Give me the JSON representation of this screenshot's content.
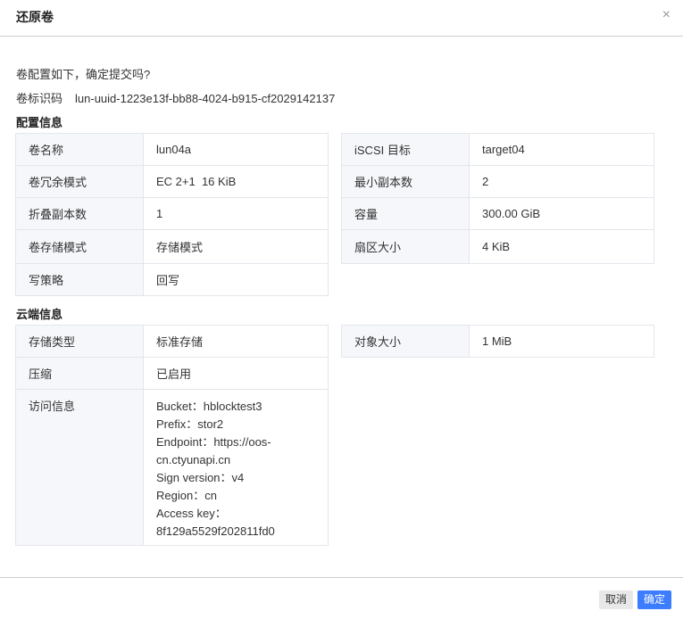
{
  "dialog": {
    "title": "还原卷",
    "close_icon": "×"
  },
  "confirm_text": "卷配置如下，确定提交吗?",
  "uuid": {
    "label": "卷标识码",
    "value": "lun-uuid-1223e13f-bb88-4024-b915-cf2029142137"
  },
  "config": {
    "heading": "配置信息",
    "left": [
      {
        "label": "卷名称",
        "value": "lun04a"
      },
      {
        "label": "卷冗余模式",
        "value": "EC 2+1  16 KiB"
      },
      {
        "label": "折叠副本数",
        "value": "1"
      },
      {
        "label": "卷存储模式",
        "value": "存储模式"
      },
      {
        "label": "写策略",
        "value": "回写"
      }
    ],
    "right": [
      {
        "label": "iSCSI 目标",
        "value": "target04"
      },
      {
        "label": "最小副本数",
        "value": "2"
      },
      {
        "label": "容量",
        "value": "300.00 GiB"
      },
      {
        "label": "扇区大小",
        "value": "4 KiB"
      }
    ]
  },
  "cloud": {
    "heading": "云端信息",
    "left": [
      {
        "label": "存储类型",
        "value": "标准存储"
      },
      {
        "label": "压缩",
        "value": "已启用"
      }
    ],
    "access": {
      "label": "访问信息",
      "lines": [
        "Bucket：hblocktest3",
        "Prefix：stor2",
        "Endpoint：https://oos-",
        "cn.ctyunapi.cn",
        "Sign version：v4",
        "Region：cn",
        "Access key：",
        "8f129a5529f202811fd0"
      ]
    },
    "right": [
      {
        "label": "对象大小",
        "value": "1 MiB"
      }
    ]
  },
  "footer": {
    "cancel": "取消",
    "ok": "确定"
  }
}
